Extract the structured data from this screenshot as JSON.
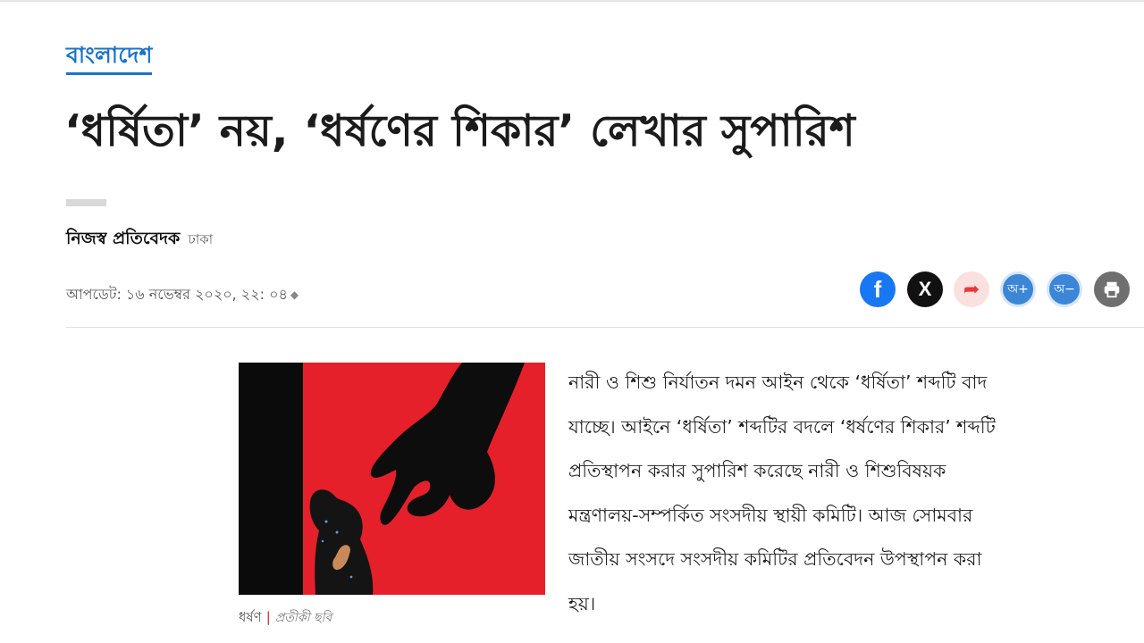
{
  "section": {
    "label": "বাংলাদেশ"
  },
  "headline": "‘ধর্ষিতা’ নয়, ‘ধর্ষণের শিকার’ লেখার সুপারিশ",
  "byline": {
    "author": "নিজস্ব প্রতিবেদক",
    "location": "ঢাকা"
  },
  "updated": {
    "text": "আপডেট: ১৬ নভেম্বর ২০২০, ২২: ০৪"
  },
  "share": {
    "facebook_icon": "f",
    "x_icon": "X",
    "share_icon": "➦",
    "font_increase_label": "অ+",
    "font_decrease_label": "অ−",
    "print_icon": "print-icon"
  },
  "figure": {
    "caption_main": "ধর্ষণ",
    "caption_sub": "প্রতীকী ছবি"
  },
  "article": {
    "paragraph": "নারী ও শিশু নির্যাতন দমন আইন থেকে ‘ধর্ষিতা’ শব্দটি বাদ যাচ্ছে। আইনে ‘ধর্ষিতা’ শব্দটির বদলে ‘ধর্ষণের শিকার’ শব্দটি প্রতিস্থাপন করার সুপারিশ করেছে নারী ও শিশুবিষয়ক মন্ত্রণালয়-সম্পর্কিত সংসদীয় স্থায়ী কমিটি। আজ সোমবার জাতীয় সংসদে সংসদীয় কমিটির প্রতিবেদন উপস্থাপন করা হয়।"
  },
  "colors": {
    "accent": "#1a73c9",
    "facebook": "#1877f2",
    "figure_red": "#e5202a"
  }
}
